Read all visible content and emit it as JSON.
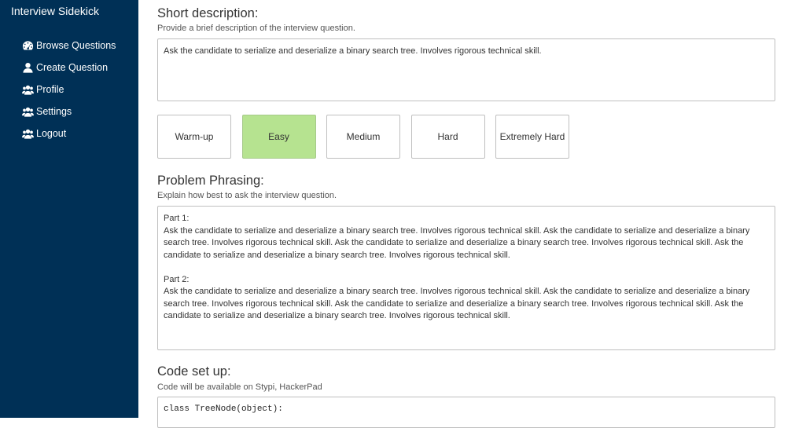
{
  "sidebar": {
    "brand": "Interview Sidekick",
    "items": [
      {
        "label": "Browse Questions",
        "icon": "dashboard-icon"
      },
      {
        "label": "Create Question",
        "icon": "user-icon"
      },
      {
        "label": "Profile",
        "icon": "users-icon"
      },
      {
        "label": "Settings",
        "icon": "users-icon"
      },
      {
        "label": "Logout",
        "icon": "users-icon"
      }
    ]
  },
  "short_description": {
    "title": "Short description:",
    "subtitle": "Provide a brief description of the interview question.",
    "value": "Ask the candidate to serialize and deserialize a binary search tree. Involves rigorous technical skill."
  },
  "difficulty": {
    "options": [
      "Warm-up",
      "Easy",
      "Medium",
      "Hard",
      "Extremely Hard"
    ],
    "selected": "Easy",
    "selected_color": "#b6e390"
  },
  "problem_phrasing": {
    "title": "Problem Phrasing:",
    "subtitle": "Explain how best to ask the interview question.",
    "value": "Part 1:\nAsk the candidate to serialize and deserialize a binary search tree. Involves rigorous technical skill. Ask the candidate to serialize and deserialize a binary search tree. Involves rigorous technical skill. Ask the candidate to serialize and deserialize a binary search tree. Involves rigorous technical skill. Ask the candidate to serialize and deserialize a binary search tree. Involves rigorous technical skill.\n\nPart 2:\nAsk the candidate to serialize and deserialize a binary search tree. Involves rigorous technical skill. Ask the candidate to serialize and deserialize a binary search tree. Involves rigorous technical skill. Ask the candidate to serialize and deserialize a binary search tree. Involves rigorous technical skill. Ask the candidate to serialize and deserialize a binary search tree. Involves rigorous technical skill."
  },
  "code_setup": {
    "title": "Code set up:",
    "subtitle": "Code will be available on Stypi, HackerPad",
    "value": "class TreeNode(object):"
  },
  "colors": {
    "sidebar_bg": "#003056",
    "border": "#bfbfbf"
  }
}
